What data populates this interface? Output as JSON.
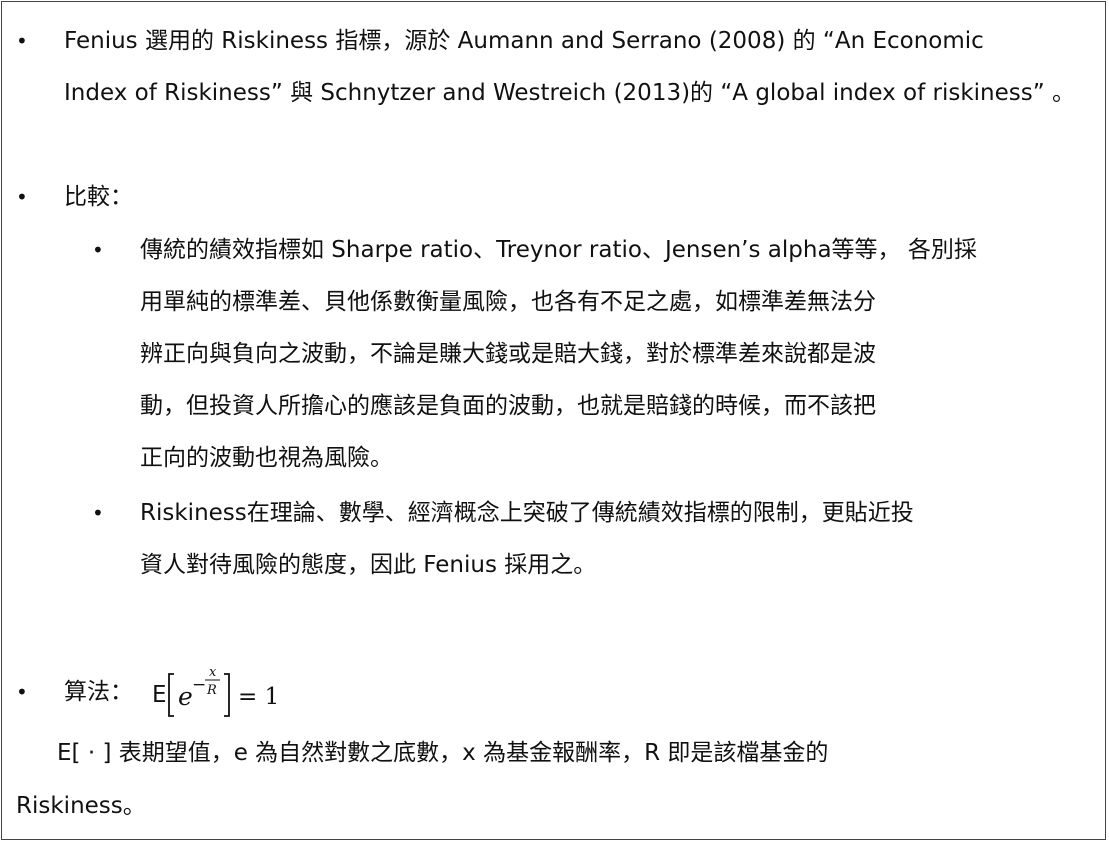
{
  "section1": {
    "bullet": "•",
    "lines": [
      "Fenius 選用的 Riskiness 指標，源於 Aumann and Serrano (2008) 的 “An Economic",
      "Index of Riskiness” 與 Schnytzer and Westreich (2013)的 “A global index of riskiness” 。"
    ]
  },
  "section2": {
    "bullet": "•",
    "heading": "比較：",
    "sub1": {
      "bullet": "•",
      "lines": [
        "傳統的績效指標如 Sharpe ratio、Treynor ratio、Jensen’s alpha等等， 各別採",
        "用單純的標準差、貝他係數衡量風險，也各有不足之處，如標準差無法分",
        "辨正向與負向之波動，不論是賺大錢或是賠大錢，對於標準差來說都是波",
        "動，但投資人所擔心的應該是負面的波動，也就是賠錢的時候，而不該把",
        "正向的波動也視為風險。"
      ]
    },
    "sub2": {
      "bullet": "•",
      "lines": [
        "Riskiness在理論、數學、經濟概念上突破了傳統績效指標的限制，更貼近投",
        "資人對待風險的態度，因此 Fenius 採用之。"
      ]
    }
  },
  "section3": {
    "bullet": "•",
    "label": "算法：",
    "formula": {
      "expectation": "E",
      "base": "e",
      "minus": "−",
      "numerator": "x",
      "denominator": "R",
      "equals": "= 1"
    },
    "explanation_lines": [
      "E[ · ] 表期望值，e 為自然對數之底數，x 為基金報酬率，R 即是該檔基金的",
      "Riskiness。"
    ]
  }
}
